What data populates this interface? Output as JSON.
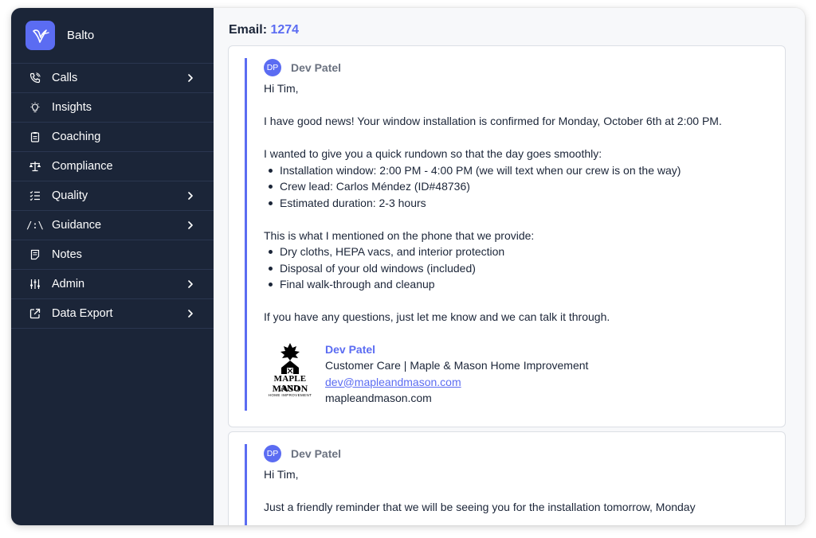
{
  "brand": {
    "name": "Balto",
    "logo_icon": "hummingbird-icon",
    "accent": "#5b6cf2"
  },
  "sidebar": {
    "items": [
      {
        "label": "Calls",
        "icon": "phone-icon",
        "has_submenu": true
      },
      {
        "label": "Insights",
        "icon": "lightbulb-icon",
        "has_submenu": false
      },
      {
        "label": "Coaching",
        "icon": "clipboard-icon",
        "has_submenu": false
      },
      {
        "label": "Compliance",
        "icon": "scale-icon",
        "has_submenu": false
      },
      {
        "label": "Quality",
        "icon": "checklist-icon",
        "has_submenu": true
      },
      {
        "label": "Guidance",
        "icon": "guidance-icon",
        "has_submenu": true
      },
      {
        "label": "Notes",
        "icon": "note-icon",
        "has_submenu": false
      },
      {
        "label": "Admin",
        "icon": "sliders-icon",
        "has_submenu": true
      },
      {
        "label": "Data Export",
        "icon": "external-link-icon",
        "has_submenu": true
      }
    ],
    "guidance_glyph": "/:\\"
  },
  "header": {
    "label": "Email:",
    "number": "1274"
  },
  "emails": [
    {
      "avatar": "DP",
      "sender": "Dev Patel",
      "greeting": "Hi Tim,",
      "line1": "I have good news! Your window installation is confirmed for Monday, October 6th at 2:00 PM.",
      "line2": "I wanted to give you a quick rundown so that the day goes smoothly:",
      "bullets1": [
        "Installation window: 2:00 PM - 4:00 PM (we will text when our crew is on the way)",
        "Crew lead: Carlos Méndez (ID#48736)",
        "Estimated duration: 2-3 hours"
      ],
      "line3": "This is what I mentioned on the phone that we provide:",
      "bullets2": [
        "Dry cloths, HEPA vacs, and interior protection",
        "Disposal of your old windows (included)",
        "Final walk-through and cleanup"
      ],
      "line4": "If you have any questions, just let me know and we can talk it through.",
      "signature": {
        "name": "Dev Patel",
        "title": "Customer Care | Maple & Mason Home Improvement",
        "email": "dev@mapleandmason.com",
        "website": "mapleandmason.com",
        "logo_line1": "MAPLE AND",
        "logo_line2": "MASON",
        "logo_line3": "HOME IMPROVEMENT"
      }
    },
    {
      "avatar": "DP",
      "sender": "Dev Patel",
      "greeting": "Hi Tim,",
      "line1": "Just a friendly reminder that we will be seeing you for the installation tomorrow, Monday"
    }
  ]
}
